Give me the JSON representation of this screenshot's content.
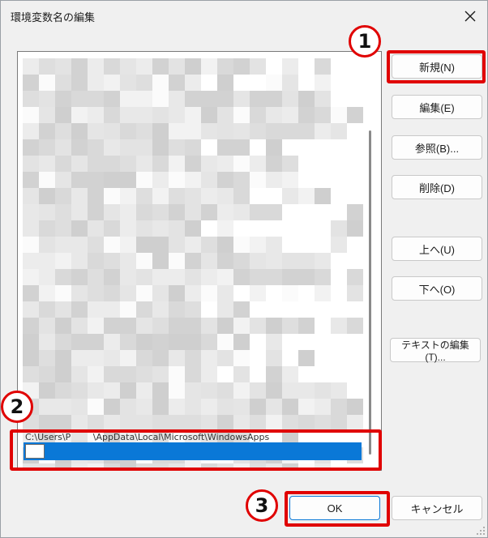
{
  "window": {
    "title": "環境変数名の編集"
  },
  "buttons": {
    "new": "新規(N)",
    "edit": "編集(E)",
    "browse": "参照(B)...",
    "delete": "削除(D)",
    "move_up": "上へ(U)",
    "move_down": "下へ(O)",
    "edit_text": "テキストの編集(T)...",
    "ok": "OK",
    "cancel": "キャンセル"
  },
  "annotations": {
    "one": "1",
    "two": "2",
    "three": "3"
  },
  "list": {
    "partial_row": "C:\\Users\\P_____\\AppData\\Local\\Microsoft\\WindowsApps",
    "new_entry_value": ""
  },
  "colors": {
    "highlight": "#e00000",
    "selection": "#0a78d7",
    "accent": "#0a78d7"
  },
  "icons": {
    "close": "close-icon",
    "resize": "resize-grip-icon"
  }
}
